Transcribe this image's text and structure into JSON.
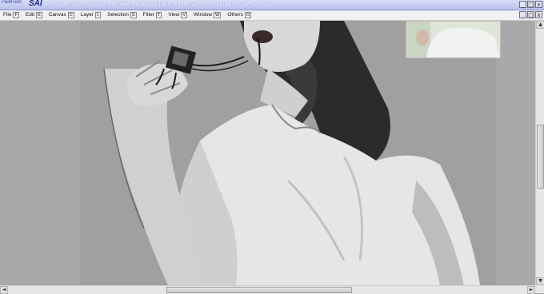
{
  "app": {
    "logo_small": "PaintTool",
    "logo_big": "SAI",
    "title": "C:\\Users\\Ocean\\Documents\\Homework\\Art\\Truth, Fantasy and Fiction\\what is life.sai (*)"
  },
  "window_buttons": [
    "_",
    "□",
    "x"
  ],
  "document_buttons": [
    "_",
    "□",
    "x"
  ],
  "menu": [
    {
      "label": "File",
      "key": "F"
    },
    {
      "label": "Edit",
      "key": "E"
    },
    {
      "label": "Canvas",
      "key": "C"
    },
    {
      "label": "Layer",
      "key": "L"
    },
    {
      "label": "Selection",
      "key": "S"
    },
    {
      "label": "Filter",
      "key": "T"
    },
    {
      "label": "View",
      "key": "V"
    },
    {
      "label": "Window",
      "key": "W"
    },
    {
      "label": "Others",
      "key": "O"
    }
  ],
  "scroll": {
    "up": "▲",
    "down": "▼",
    "left": "◄",
    "right": "►"
  },
  "colors": {
    "titlebar": "#c8ccf2",
    "canvas_bg": "#a9a9a9",
    "menubar": "#f0f0f0"
  }
}
